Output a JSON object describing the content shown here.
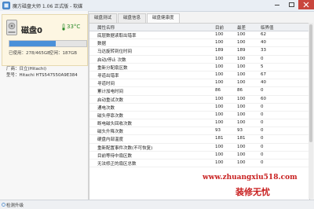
{
  "window": {
    "title": "魔方磁盘大师 1.06 正式版 - 软媒"
  },
  "left_panel": {
    "disk_name": "磁盘0",
    "temperature": "33°C",
    "usage_fraction": 0.6,
    "used_text": "已使用：278/465GB",
    "free_text": "空闲：187GB",
    "vendor": "厂商：日立(Hitachi)",
    "model": "型号：Hitachi HTS547550A9E384"
  },
  "tabs": [
    {
      "label": "磁盘测试"
    },
    {
      "label": "磁盘信息"
    },
    {
      "label": "磁盘健康度"
    }
  ],
  "table": {
    "headers": {
      "name": "属性名称",
      "current": "目前",
      "worst": "最差",
      "threshold": "临界值"
    },
    "rows": [
      {
        "name": "底层数据读取出错率",
        "current": "100",
        "worst": "100",
        "threshold": "62"
      },
      {
        "name": "数据",
        "current": "100",
        "worst": "100",
        "threshold": "40"
      },
      {
        "name": "马达旋转到位时间",
        "current": "189",
        "worst": "189",
        "threshold": "33"
      },
      {
        "name": "启动/停止 次数",
        "current": "100",
        "worst": "100",
        "threshold": "0"
      },
      {
        "name": "重新分配扇区数",
        "current": "100",
        "worst": "100",
        "threshold": "5"
      },
      {
        "name": "寻道出错率",
        "current": "100",
        "worst": "100",
        "threshold": "67"
      },
      {
        "name": "寻道时间",
        "current": "100",
        "worst": "100",
        "threshold": "40"
      },
      {
        "name": "累计加电时间",
        "current": "86",
        "worst": "86",
        "threshold": "0"
      },
      {
        "name": "启动重试次数",
        "current": "100",
        "worst": "100",
        "threshold": "60"
      },
      {
        "name": "通电次数",
        "current": "100",
        "worst": "100",
        "threshold": "0"
      },
      {
        "name": "磁头停靠次数",
        "current": "100",
        "worst": "100",
        "threshold": "0"
      },
      {
        "name": "断电磁头回收次数",
        "current": "100",
        "worst": "100",
        "threshold": "0"
      },
      {
        "name": "磁头升降次数",
        "current": "93",
        "worst": "93",
        "threshold": "0"
      },
      {
        "name": "硬盘内部温度",
        "current": "181",
        "worst": "181",
        "threshold": "0"
      },
      {
        "name": "重新配置事件次数(不可恢复)",
        "current": "100",
        "worst": "100",
        "threshold": "0"
      },
      {
        "name": "目前等待中扇区数",
        "current": "100",
        "worst": "100",
        "threshold": "0"
      },
      {
        "name": "无法修正的扇区总数",
        "current": "100",
        "worst": "100",
        "threshold": "0"
      }
    ]
  },
  "bottom": {
    "check_update": "检测升级"
  },
  "watermark": {
    "url": "www.zhuangxiu518.com",
    "text": "装修无忧"
  }
}
